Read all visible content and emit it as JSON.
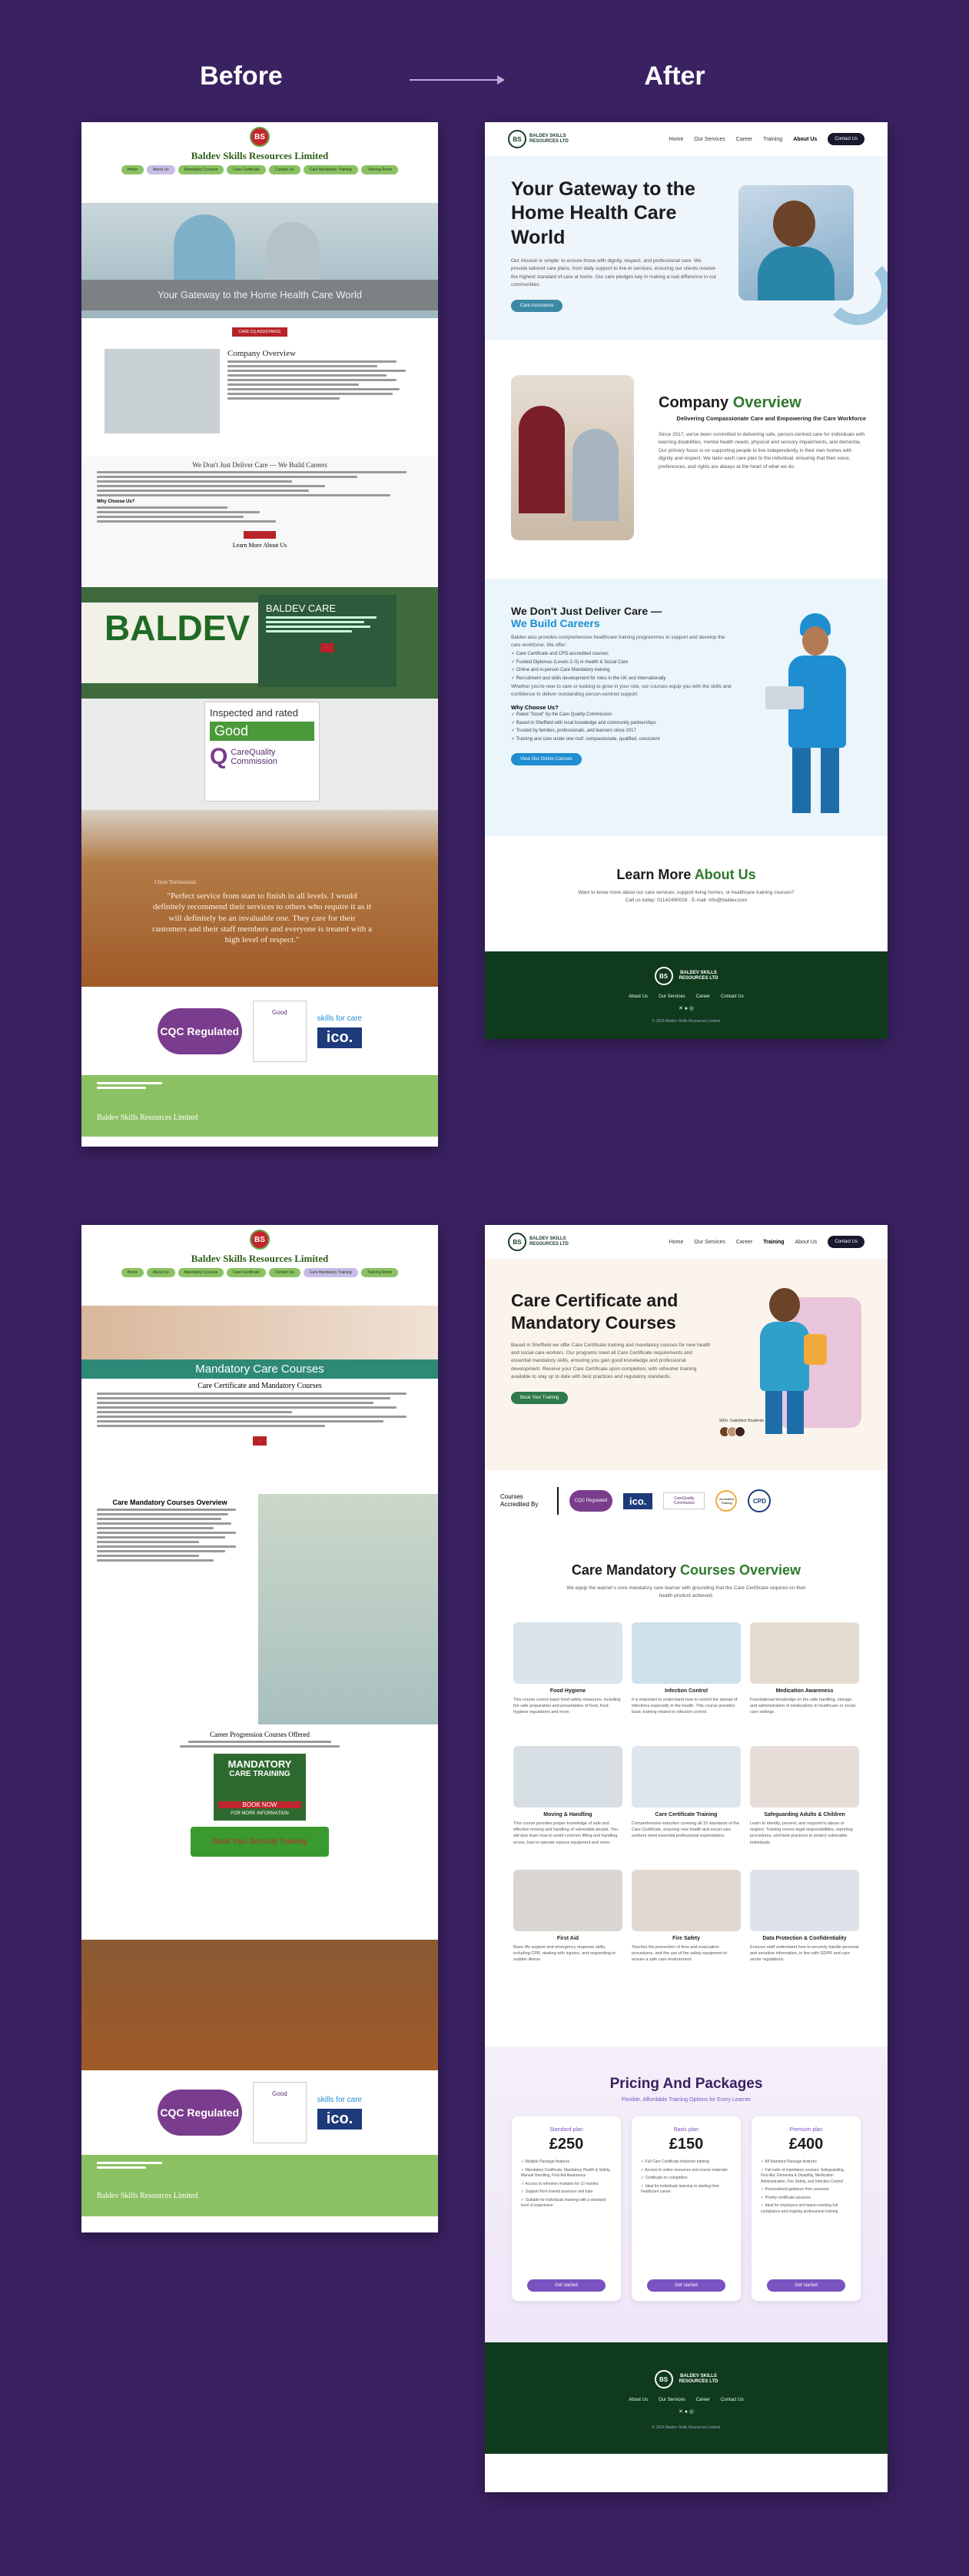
{
  "labels": {
    "before": "Before",
    "after": "After"
  },
  "colors": {
    "background": "#3a2161",
    "accent_green": "#2e7a2b",
    "accent_blue": "#1f8ed1",
    "footer": "#103a1c"
  },
  "old_site": {
    "brand": "Baldev Skills Resources Limited",
    "logo_text": "BS",
    "nav": [
      "Home",
      "About Us",
      "Mandatory Courses",
      "Care Certificate",
      "Contact Us"
    ],
    "nav_secondary": [
      "Care Mandatory Training",
      "Training Room"
    ],
    "hero_title": "Your Gateway to the Home Health Care World",
    "hero_button": "CARE CQ ASSISTANCE",
    "overview_title": "Company Overview",
    "careers_title": "We Don't Just Deliver Care — We Build Careers",
    "why_title": "Why Choose Us?",
    "learn_title": "Learn More About Us",
    "baldev_care_big": "BALDEV CARE",
    "baldev_care_title": "BALDEV CARE",
    "inspected": "Inspected and rated",
    "good": "Good",
    "cqc_name": "CareQuality Commission",
    "testimonial_title": "Client Testimonials",
    "testimonial": "\"Perfect service from start to finish in all levels. I would definitely recommend their services to others who require it as it will definitely be an invaluable one. They care for their customers and their staff members and everyone is treated with a high level of respect.\"",
    "cqc_regulated": "CQC Regulated",
    "ico": "ico.",
    "skills_care": "skills for care",
    "footer_brand": "Baldev Skills Resources Limited",
    "page2_banner": "Mandatory Care Courses",
    "page2_sub": "Care Certificate and Mandatory Courses",
    "page2_overview": "Care Mandatory Courses Overview",
    "page2_progression": "Career Progression Courses Offered",
    "mandatory_box": [
      "MANDATORY",
      "CARE TRAINING"
    ],
    "book_now": "BOOK NOW",
    "for_more": "FOR MORE INFORMATION",
    "security": "Book Your Security Training"
  },
  "new_site1": {
    "logo_text": "BS",
    "brand": [
      "BALDEV SKILLS",
      "RESOURCES LTD"
    ],
    "nav": [
      "Home",
      "Our Services",
      "Career",
      "Training",
      "About Us"
    ],
    "active_nav": "About Us",
    "contact": "Contact Us",
    "hero_title": "Your Gateway to the Home Health Care World",
    "hero_text": "Our mission is simple: to ensure those with dignity, respect, and professional care. We provide tailored care plans, from daily support to live-in services, ensuring our clients receive the highest standard of care at home. Our care pledges key in making a real difference in our communities.",
    "hero_button": "Care Assistance",
    "overview_title_1": "Company",
    "overview_title_2": "Overview",
    "overview_sub": "Delivering Compassionate Care and Empowering the Care Workforce",
    "overview_text": "Since 2017, we've been committed to delivering safe, person-centred care for individuals with learning disabilities, mental health needs, physical and sensory impairments, and dementia. Our primary focus is on supporting people to live independently in their own homes with dignity and respect. We tailor each care plan to the individual, ensuring that their voice, preferences, and rights are always at the heart of what we do.",
    "careers_title_1": "We Don't Just Deliver Care —",
    "careers_title_2": "We Build Careers",
    "careers_text": "Baldev also provides comprehensive healthcare training programmes to support and develop the care workforce. We offer:",
    "careers_list": [
      "Care Certificate and CPD-accredited courses",
      "Funded Diplomas (Levels 2–5) in Health & Social Care",
      "Online and in-person Care Mandatory training",
      "Recruitment and skills development for roles in the UK and internationally"
    ],
    "careers_after": "Whether you're new to care or looking to grow in your role, our courses equip you with the skills and confidence to deliver outstanding person-centred support.",
    "why_title": "Why Choose Us?",
    "why_list": [
      "Rated \"Good\" by the Care Quality Commission",
      "Based in Sheffield with local knowledge and community partnerships",
      "Trusted by families, professionals, and learners since 2017",
      "Training and care under one roof: compassionate, qualified, consistent"
    ],
    "careers_button": "View Our Online Courses",
    "learn_title_1": "Learn More",
    "learn_title_2": "About Us",
    "learn_text": "Want to know more about our care services, support living homes, or healthcare training courses?",
    "learn_contact": "Call us today: 01142490028 · E-mail: info@baldev.com",
    "footer_links": [
      "About Us",
      "Our Services",
      "Career",
      "Contact Us"
    ],
    "copyright": "© 2024 Baldev Skills Resources Limited"
  },
  "new_site2": {
    "nav": [
      "Home",
      "Our Services",
      "Career",
      "Training",
      "About Us"
    ],
    "active_nav": "Training",
    "contact": "Contact Us",
    "hero_title": "Care Certificate and Mandatory Courses",
    "hero_text": "Based in Sheffield we offer Care Certificate training and mandatory courses for new health and social care workers. Our programs meet all Care Certificate requirements and essential mandatory skills, ensuring you gain good knowledge and professional development. Receive your Care Certificate upon completion, with refresher training available to stay up to date with best practices and regulatory standards.",
    "hero_button": "Book Your Training",
    "students": "900+ Satisfied Students",
    "accredited": "Courses Accredited By",
    "accreditors": [
      "CQC Regulated",
      "ico.",
      "CareQuality Commission",
      "Accredited Training",
      "CPD"
    ],
    "overview_title_1": "Care Mandatory",
    "overview_title_2": "Courses Overview",
    "overview_text": "We equip the learner's core mandatory care learner with grounding that the Care Certificate requires on their health product achieved.",
    "courses": [
      {
        "title": "Food Hygiene",
        "text": "This course covers basic food safety measures, including the safe preparation and presentation of food, food hygiene regulations and more."
      },
      {
        "title": "Infection Control",
        "text": "It is important to understand how to control the spread of infections especially in the health. This course provides basic training related to infection control."
      },
      {
        "title": "Medication Awareness",
        "text": "Foundational knowledge on the safe handling, storage, and administration of medications in healthcare or social care settings."
      },
      {
        "title": "Moving & Handling",
        "text": "This course provides proper knowledge of safe and effective moving and handling of vulnerable people. You will also learn how to avoid common lifting and handling errors, how to operate various equipment and more."
      },
      {
        "title": "Care Certificate Training",
        "text": "Comprehensive induction covering all 15 standards of the Care Certificate, ensuring new health and social care workers meet essential professional expectations."
      },
      {
        "title": "Safeguarding Adults & Children",
        "text": "Learn to identify, prevent, and respond to abuse or neglect. Training covers legal responsibilities, reporting procedures, and best practices to protect vulnerable individuals."
      },
      {
        "title": "First Aid",
        "text": "Basic life support and emergency response skills, including CPR, dealing with injuries, and responding to sudden illness."
      },
      {
        "title": "Fire Safety",
        "text": "Teaches the prevention of fires and evacuation procedures, and the use of fire safety equipment to ensure a safe care environment."
      },
      {
        "title": "Data Protection & Confidentiality",
        "text": "Ensures staff understand how to securely handle personal and sensitive information, in line with GDPR and care sector regulations."
      }
    ],
    "pricing_title": "Pricing And Packages",
    "pricing_sub": "Flexible, Affordable Training Options for Every Learner",
    "plans": [
      {
        "name": "Standard plan",
        "price": "£250",
        "features": [
          "Multiple Package features",
          "Mandatory Certificate, Mandatory Health & Safety, Manual Handling, First Aid Awareness",
          "Access to refresher modules for 12 months",
          "Support from trained assessor and tutor",
          "Suitable for individuals learning with a standard level of experience"
        ],
        "button": "Get started"
      },
      {
        "name": "Basic plan",
        "price": "£150",
        "features": [
          "Full Care Certificate induction training",
          "Access to online resources and course materials",
          "Certificate on completion",
          "Ideal for individuals learning to starting their healthcare career"
        ],
        "button": "Get started"
      },
      {
        "name": "Premium plan",
        "price": "£400",
        "features": [
          "All Standard Package features",
          "Full suite of mandatory courses: Safeguarding, First Aid, Dementia & Disability, Medication Administration, Fire Safety, and Infection Control",
          "Personalised guidance from assessor",
          "Priority certificate issuance",
          "Ideal for employers and teams needing full compliance and ongoing professional training"
        ],
        "button": "Get started"
      }
    ],
    "footer_links": [
      "About Us",
      "Our Services",
      "Career",
      "Contact Us"
    ],
    "copyright": "© 2024 Baldev Skills Resources Limited"
  }
}
